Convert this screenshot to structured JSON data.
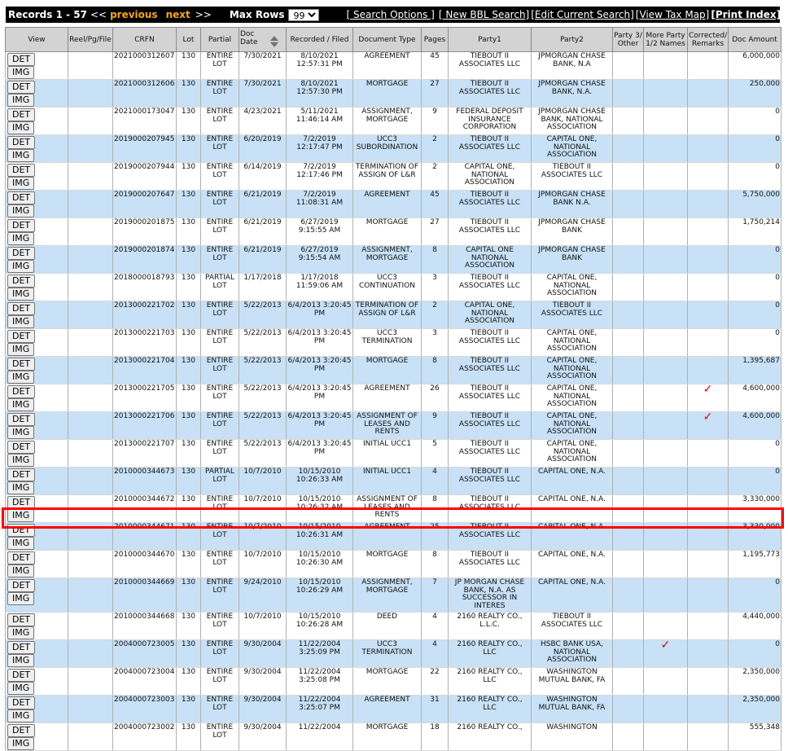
{
  "toolbar": {
    "records_label": "Records 1 - 57",
    "prev_arrows": "<<",
    "previous": "previous",
    "next": "next",
    "next_arrows": ">>",
    "max_rows_label": "Max Rows",
    "max_rows_value": "99",
    "links": [
      "[ Search Options ]",
      "[ New BBL Search]",
      "[Edit Current Search]",
      "[View Tax Map]",
      "[Print Index]"
    ]
  },
  "columns": [
    "View",
    "Reel/Pg/File",
    "CRFN",
    "Lot",
    "Partial",
    "Doc Date",
    "Recorded / Filed",
    "Document Type",
    "Pages",
    "Party1",
    "Party2",
    "Party 3/ Other",
    "More Party 1/2 Names",
    "Corrected/ Remarks",
    "Doc Amount"
  ],
  "buttons": {
    "det": "DET",
    "img": "IMG"
  },
  "rows": [
    {
      "crfn": "2021000312607",
      "lot": "130",
      "partial": "ENTIRE LOT",
      "doc_date": "7/30/2021",
      "recorded": "8/10/2021 12:57:31 PM",
      "doc_type": "AGREEMENT",
      "pages": "45",
      "party1": "TIEBOUT II ASSOCIATES LLC",
      "party2": "JPMORGAN CHASE BANK, N.A",
      "corrected": false,
      "amount": "6,000,000"
    },
    {
      "crfn": "2021000312606",
      "lot": "130",
      "partial": "ENTIRE LOT",
      "doc_date": "7/30/2021",
      "recorded": "8/10/2021 12:57:30 PM",
      "doc_type": "MORTGAGE",
      "pages": "27",
      "party1": "TIEBOUT II ASSOCIATES LLC",
      "party2": "JPMORGAN CHASE BANK, N.A.",
      "corrected": false,
      "amount": "250,000"
    },
    {
      "crfn": "2021000173047",
      "lot": "130",
      "partial": "ENTIRE LOT",
      "doc_date": "4/23/2021",
      "recorded": "5/11/2021 11:46:14 AM",
      "doc_type": "ASSIGNMENT, MORTGAGE",
      "pages": "9",
      "party1": "FEDERAL DEPOSIT INSURANCE CORPORATION",
      "party2": "JPMORGAN CHASE BANK, NATIONAL ASSOCIATION",
      "corrected": false,
      "amount": "0"
    },
    {
      "crfn": "2019000207945",
      "lot": "130",
      "partial": "ENTIRE LOT",
      "doc_date": "6/20/2019",
      "recorded": "7/2/2019 12:17:47 PM",
      "doc_type": "UCC3 SUBORDINATION",
      "pages": "2",
      "party1": "TIEBOUT II ASSOCIATES LLC",
      "party2": "CAPITAL ONE, NATIONAL ASSOCIATION",
      "corrected": false,
      "amount": "0"
    },
    {
      "crfn": "2019000207944",
      "lot": "130",
      "partial": "ENTIRE LOT",
      "doc_date": "6/14/2019",
      "recorded": "7/2/2019 12:17:46 PM",
      "doc_type": "TERMINATION OF ASSIGN OF L&R",
      "pages": "2",
      "party1": "CAPITAL ONE, NATIONAL ASSOCIATION",
      "party2": "TIEBOUT II ASSOCIATES LLC",
      "corrected": false,
      "amount": "0"
    },
    {
      "crfn": "2019000207647",
      "lot": "130",
      "partial": "ENTIRE LOT",
      "doc_date": "6/21/2019",
      "recorded": "7/2/2019 11:08:31 AM",
      "doc_type": "AGREEMENT",
      "pages": "45",
      "party1": "TIEBOUT II ASSOCIATES LLC",
      "party2": "JPMORGAN CHASE BANK N.A.",
      "corrected": false,
      "amount": "5,750,000"
    },
    {
      "crfn": "2019000201875",
      "lot": "130",
      "partial": "ENTIRE LOT",
      "doc_date": "6/21/2019",
      "recorded": "6/27/2019 9:15:55 AM",
      "doc_type": "MORTGAGE",
      "pages": "27",
      "party1": "TIEBOUT II ASSOCIATES LLC",
      "party2": "JPMORGAN CHASE BANK",
      "corrected": false,
      "amount": "1,750,214"
    },
    {
      "crfn": "2019000201874",
      "lot": "130",
      "partial": "ENTIRE LOT",
      "doc_date": "6/21/2019",
      "recorded": "6/27/2019 9:15:54 AM",
      "doc_type": "ASSIGNMENT, MORTGAGE",
      "pages": "8",
      "party1": "CAPITAL ONE NATIONAL ASSOCIATION",
      "party2": "JPMORGAN CHASE BANK",
      "corrected": false,
      "amount": "0"
    },
    {
      "crfn": "2018000018793",
      "lot": "130",
      "partial": "PARTIAL LOT",
      "doc_date": "1/17/2018",
      "recorded": "1/17/2018 11:59:06 AM",
      "doc_type": "UCC3 CONTINUATION",
      "pages": "3",
      "party1": "TIEBOUT II ASSOCIATES LLC",
      "party2": "CAPITAL ONE, NATIONAL ASSOCIATION",
      "corrected": false,
      "amount": "0"
    },
    {
      "crfn": "2013000221702",
      "lot": "130",
      "partial": "ENTIRE LOT",
      "doc_date": "5/22/2013",
      "recorded": "6/4/2013 3:20:45 PM",
      "doc_type": "TERMINATION OF ASSIGN OF L&R",
      "pages": "2",
      "party1": "CAPITAL ONE, NATIONAL ASSOCIATION",
      "party2": "TIEBOUT II ASSOCIATES LLC",
      "corrected": false,
      "amount": "0"
    },
    {
      "crfn": "2013000221703",
      "lot": "130",
      "partial": "ENTIRE LOT",
      "doc_date": "5/22/2013",
      "recorded": "6/4/2013 3:20:45 PM",
      "doc_type": "UCC3 TERMINATION",
      "pages": "3",
      "party1": "TIEBOUT II ASSOCIATES LLC",
      "party2": "CAPITAL ONE, NATIONAL ASSOCIATION",
      "corrected": false,
      "amount": "0"
    },
    {
      "crfn": "2013000221704",
      "lot": "130",
      "partial": "ENTIRE LOT",
      "doc_date": "5/22/2013",
      "recorded": "6/4/2013 3:20:45 PM",
      "doc_type": "MORTGAGE",
      "pages": "8",
      "party1": "TIEBOUT II ASSOCIATES LLC",
      "party2": "CAPITAL ONE, NATIONAL ASSOCIATION",
      "corrected": false,
      "amount": "1,395,687"
    },
    {
      "crfn": "2013000221705",
      "lot": "130",
      "partial": "ENTIRE LOT",
      "doc_date": "5/22/2013",
      "recorded": "6/4/2013 3:20:45 PM",
      "doc_type": "AGREEMENT",
      "pages": "26",
      "party1": "TIEBOUT II ASSOCIATES LLC",
      "party2": "CAPITAL ONE, NATIONAL ASSOCIATION",
      "corrected": true,
      "amount": "4,600,000"
    },
    {
      "crfn": "2013000221706",
      "lot": "130",
      "partial": "ENTIRE LOT",
      "doc_date": "5/22/2013",
      "recorded": "6/4/2013 3:20:45 PM",
      "doc_type": "ASSIGNMENT OF LEASES AND RENTS",
      "pages": "9",
      "party1": "TIEBOUT II ASSOCIATES LLC",
      "party2": "CAPITAL ONE, NATIONAL ASSOCIATION",
      "corrected": true,
      "amount": "4,600,000"
    },
    {
      "crfn": "2013000221707",
      "lot": "130",
      "partial": "ENTIRE LOT",
      "doc_date": "5/22/2013",
      "recorded": "6/4/2013 3:20:45 PM",
      "doc_type": "INITIAL UCC1",
      "pages": "5",
      "party1": "TIEBOUT II ASSOCIATES LLC",
      "party2": "CAPITAL ONE, NATIONAL ASSOCIATION",
      "corrected": false,
      "amount": "0"
    },
    {
      "crfn": "2010000344673",
      "lot": "130",
      "partial": "PARTIAL LOT",
      "doc_date": "10/7/2010",
      "recorded": "10/15/2010 10:26:33 AM",
      "doc_type": "INITIAL UCC1",
      "pages": "4",
      "party1": "TIEBOUT II ASSOCIATES LLC",
      "party2": "CAPITAL ONE, N.A.",
      "corrected": false,
      "amount": "0"
    },
    {
      "crfn": "2010000344672",
      "lot": "130",
      "partial": "ENTIRE LOT",
      "doc_date": "10/7/2010",
      "recorded": "10/15/2010 10:26:32 AM",
      "doc_type": "ASSIGNMENT OF LEASES AND RENTS",
      "pages": "8",
      "party1": "TIEBOUT II ASSOCIATES LLC",
      "party2": "CAPITAL ONE, N.A.",
      "corrected": false,
      "amount": "3,330,000"
    },
    {
      "crfn": "2010000344671",
      "lot": "130",
      "partial": "ENTIRE LOT",
      "doc_date": "10/7/2010",
      "recorded": "10/15/2010 10:26:31 AM",
      "doc_type": "AGREEMENT",
      "pages": "25",
      "party1": "TIEBOUT II ASSOCIATES LLC",
      "party2": "CAPITAL ONE, N.A.",
      "corrected": false,
      "amount": "3,330,000"
    },
    {
      "crfn": "2010000344670",
      "lot": "130",
      "partial": "ENTIRE LOT",
      "doc_date": "10/7/2010",
      "recorded": "10/15/2010 10:26:30 AM",
      "doc_type": "MORTGAGE",
      "pages": "8",
      "party1": "TIEBOUT II ASSOCIATES LLC",
      "party2": "CAPITAL ONE, N.A.",
      "corrected": false,
      "amount": "1,195,773"
    },
    {
      "crfn": "2010000344669",
      "lot": "130",
      "partial": "ENTIRE LOT",
      "doc_date": "9/24/2010",
      "recorded": "10/15/2010 10:26:29 AM",
      "doc_type": "ASSIGNMENT, MORTGAGE",
      "pages": "7",
      "party1": "JP MORGAN CHASE BANK, N.A. AS SUCCESSOR IN INTERES",
      "party2": "CAPITAL ONE, N.A.",
      "corrected": false,
      "amount": "0"
    },
    {
      "crfn": "2010000344668",
      "lot": "130",
      "partial": "ENTIRE LOT",
      "doc_date": "10/7/2010",
      "recorded": "10/15/2010 10:26:28 AM",
      "doc_type": "DEED",
      "pages": "4",
      "party1": "2160 REALTY CO., L.L.C.",
      "party2": "TIEBOUT II ASSOCIATES LLC",
      "corrected": false,
      "amount": "4,440,000"
    },
    {
      "crfn": "2004000723005",
      "lot": "130",
      "partial": "ENTIRE LOT",
      "doc_date": "9/30/2004",
      "recorded": "11/22/2004 3:25:09 PM",
      "doc_type": "UCC3 TERMINATION",
      "pages": "4",
      "party1": "2160 REALTY CO., LLC",
      "party2": "HSBC BANK USA, NATIONAL ASSOCIATION",
      "corrected": true,
      "amount": "0"
    },
    {
      "crfn": "2004000723004",
      "lot": "130",
      "partial": "ENTIRE LOT",
      "doc_date": "9/30/2004",
      "recorded": "11/22/2004 3:25:08 PM",
      "doc_type": "MORTGAGE",
      "pages": "22",
      "party1": "2160 REALTY CO., LLC",
      "party2": "WASHINGTON MUTUAL BANK, FA",
      "corrected": false,
      "amount": "2,350,000"
    },
    {
      "crfn": "2004000723003",
      "lot": "130",
      "partial": "ENTIRE LOT",
      "doc_date": "9/30/2004",
      "recorded": "11/22/2004 3:25:07 PM",
      "doc_type": "AGREEMENT",
      "pages": "31",
      "party1": "2160 REALTY CO., LLC",
      "party2": "WASHINGTON MUTUAL BANK, FA",
      "corrected": false,
      "amount": "2,350,000"
    },
    {
      "crfn": "2004000723002",
      "lot": "130",
      "partial": "ENTIRE LOT",
      "doc_date": "9/30/2004",
      "recorded": "11/22/2004",
      "doc_type": "MORTGAGE",
      "pages": "18",
      "party1": "2160 REALTY CO.,",
      "party2": "WASHINGTON",
      "corrected": false,
      "amount": "555,348"
    }
  ],
  "colors": {
    "row_alt": "#c8e1f6",
    "header_bg": "#d3d3d3",
    "highlight": "#ff0000",
    "nav_link": "#f5a623"
  },
  "icons": {
    "sort": "sort-arrows-icon",
    "check": "red-checkmark-icon"
  }
}
